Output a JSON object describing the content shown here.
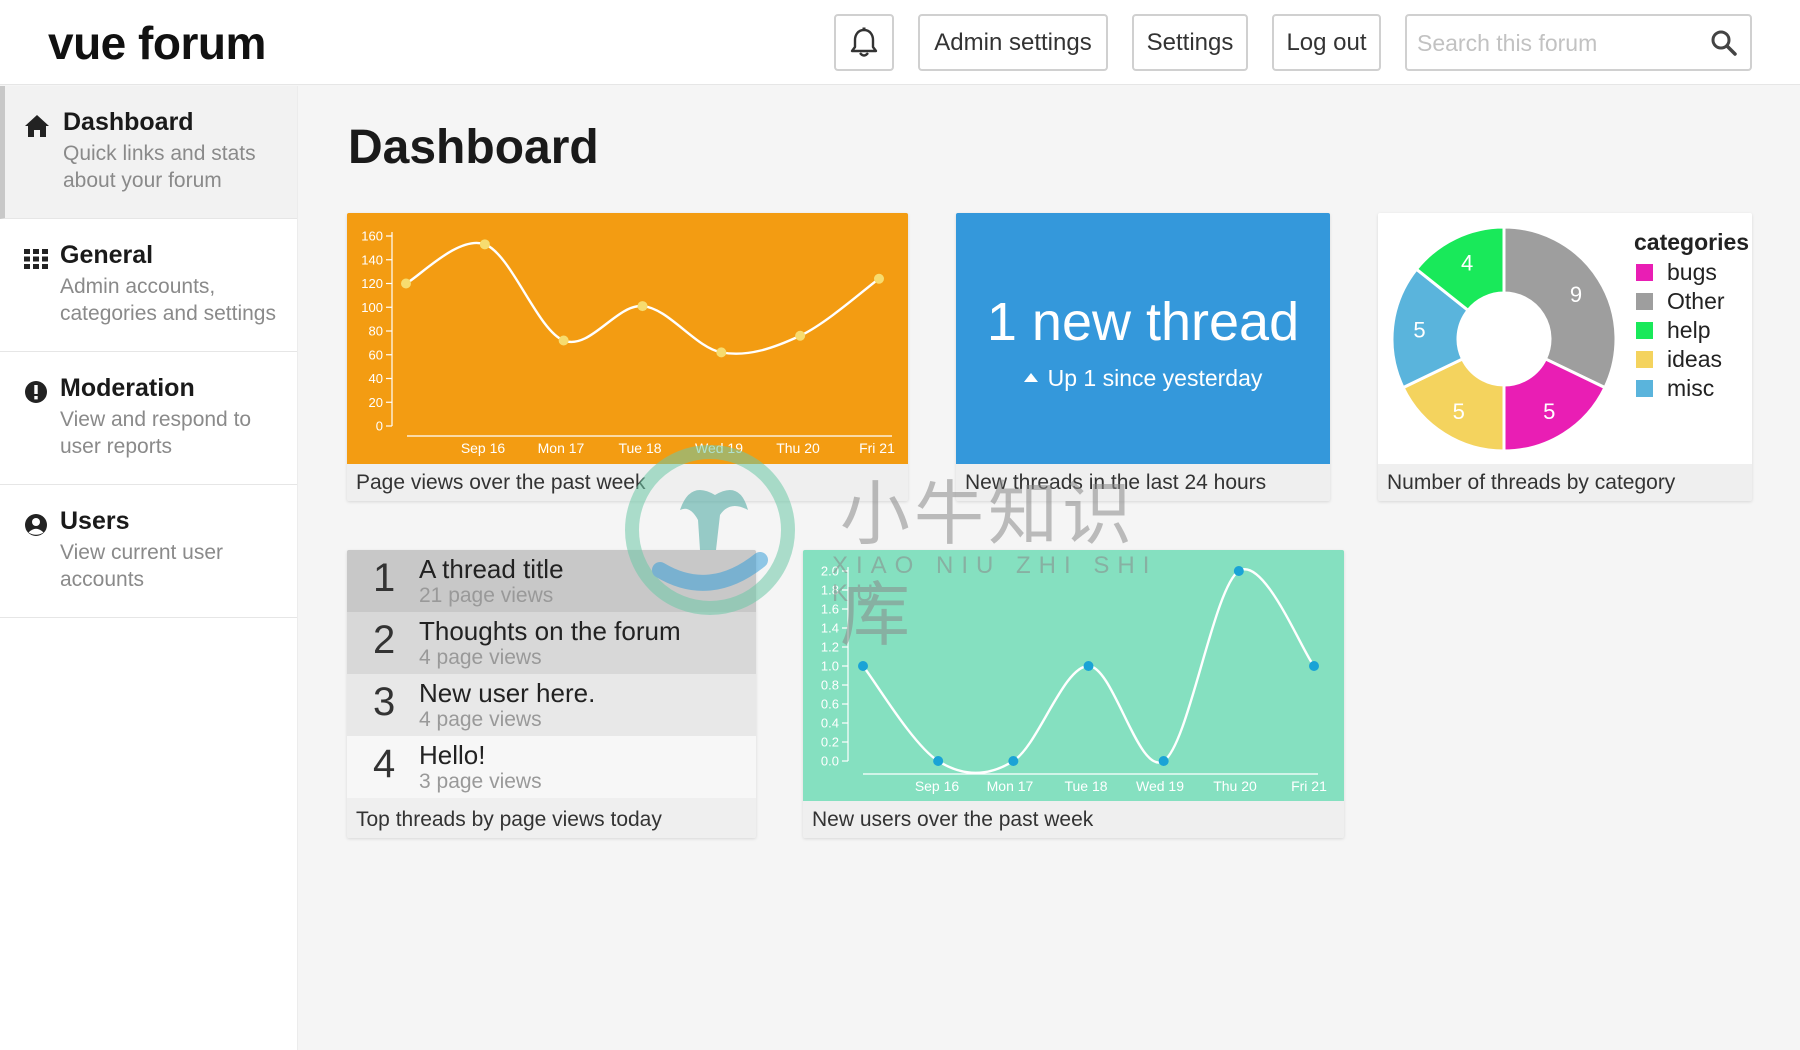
{
  "header": {
    "logo": "vue forum",
    "buttons": {
      "admin": "Admin settings",
      "settings": "Settings",
      "logout": "Log out"
    },
    "search": {
      "placeholder": "Search this forum",
      "value": ""
    }
  },
  "sidebar": {
    "items": [
      {
        "title": "Dashboard",
        "desc": "Quick links and stats about your forum",
        "icon": "home-icon",
        "active": true
      },
      {
        "title": "General",
        "desc": "Admin accounts, categories and settings",
        "icon": "grid-icon",
        "active": false
      },
      {
        "title": "Moderation",
        "desc": "View and respond to user reports",
        "icon": "alert-icon",
        "active": false
      },
      {
        "title": "Users",
        "desc": "View current user accounts",
        "icon": "user-icon",
        "active": false
      }
    ]
  },
  "main": {
    "title": "Dashboard",
    "new_threads": {
      "headline": "1 new thread",
      "sub": "Up 1 since yesterday",
      "caption": "New threads in the last 24 hours"
    },
    "top_threads": {
      "caption": "Top threads by page views today",
      "items": [
        {
          "rank": "1",
          "title": "A thread title",
          "views": "21 page views"
        },
        {
          "rank": "2",
          "title": "Thoughts on the forum",
          "views": "4 page views"
        },
        {
          "rank": "3",
          "title": "New user here.",
          "views": "4 page views"
        },
        {
          "rank": "4",
          "title": "Hello!",
          "views": "3 page views"
        }
      ]
    }
  },
  "chart_data": [
    {
      "type": "line",
      "caption": "Page views over the past week",
      "x": [
        "Sep 16",
        "Mon 17",
        "Tue 18",
        "Wed 19",
        "Thu 20",
        "Fri 21"
      ],
      "values": [
        120,
        153,
        72,
        101,
        62,
        76,
        124
      ],
      "yticks": [
        0,
        20,
        40,
        60,
        80,
        100,
        120,
        140,
        160
      ],
      "ylim": [
        0,
        160
      ],
      "color": "#f39c12",
      "point_color": "#f7dc6f"
    },
    {
      "type": "pie",
      "caption": "Number of threads by category",
      "legend_title": "categories",
      "slices": [
        {
          "label": "Other",
          "value": 9,
          "color": "#9e9e9e"
        },
        {
          "label": "bugs",
          "value": 5,
          "color": "#e91eb4"
        },
        {
          "label": "ideas",
          "value": 5,
          "color": "#f4d35e"
        },
        {
          "label": "misc",
          "value": 5,
          "color": "#5ab4dc"
        },
        {
          "label": "help",
          "value": 4,
          "color": "#19e95a"
        }
      ],
      "legend_order": [
        "bugs",
        "Other",
        "help",
        "ideas",
        "misc"
      ]
    },
    {
      "type": "line",
      "caption": "New users over the past week",
      "x": [
        "Sep 16",
        "Mon 17",
        "Tue 18",
        "Wed 19",
        "Thu 20",
        "Fri 21"
      ],
      "values": [
        1,
        0,
        0,
        1,
        0,
        2,
        1
      ],
      "yticks": [
        "0.0",
        "0.2",
        "0.4",
        "0.6",
        "0.8",
        "1.0",
        "1.2",
        "1.4",
        "1.6",
        "1.8",
        "2.0"
      ],
      "ylim": [
        0,
        2
      ],
      "color": "#85e0c0",
      "point_color": "#1aa3d6"
    }
  ],
  "watermark": {
    "cn": "小牛知识库",
    "en": "XIAO NIU ZHI SHI KU"
  }
}
